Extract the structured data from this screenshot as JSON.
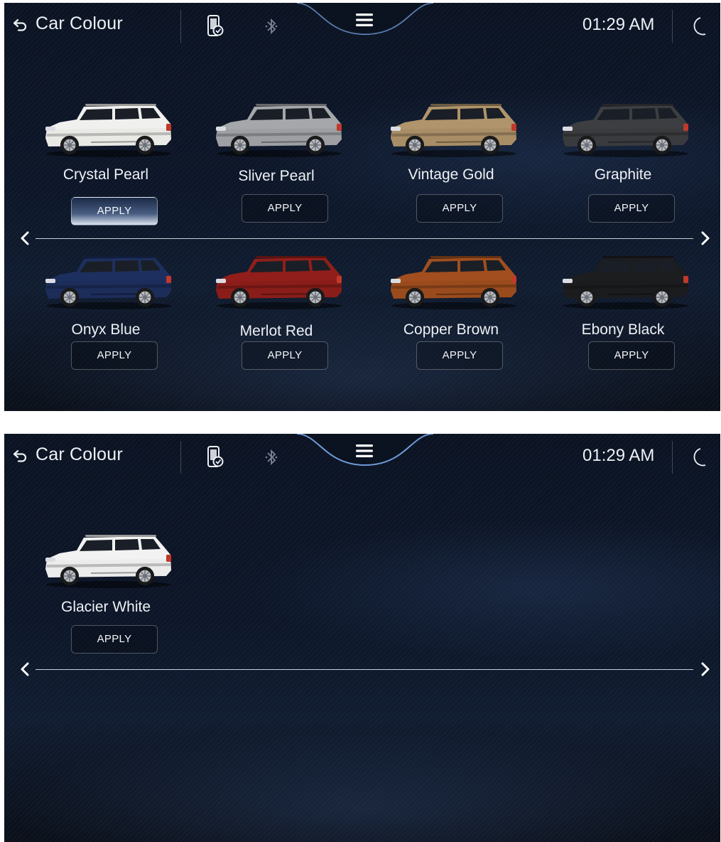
{
  "header": {
    "title": "Car Colour",
    "clock": "01:29 AM",
    "icons": [
      "back-icon",
      "phone-sync-icon",
      "bluetooth-icon",
      "menu-icon",
      "moon-icon"
    ]
  },
  "colors": {
    "accent": "#6f9bd6",
    "background": "#0c1628"
  },
  "page1": {
    "cars": [
      {
        "name": "Crystal Pearl",
        "apply_label": "APPLY",
        "color": "#e9e9e6",
        "selected": true
      },
      {
        "name": "Sliver Pearl",
        "apply_label": "APPLY",
        "color": "#9d9fa3",
        "selected": false
      },
      {
        "name": "Vintage Gold",
        "apply_label": "APPLY",
        "color": "#a88d66",
        "selected": false
      },
      {
        "name": "Graphite",
        "apply_label": "APPLY",
        "color": "#3a3b3e",
        "selected": false
      },
      {
        "name": "Onyx Blue",
        "apply_label": "APPLY",
        "color": "#1c2d5a",
        "selected": false
      },
      {
        "name": "Merlot Red",
        "apply_label": "APPLY",
        "color": "#8a1d19",
        "selected": false
      },
      {
        "name": "Copper Brown",
        "apply_label": "APPLY",
        "color": "#9a4b1d",
        "selected": false
      },
      {
        "name": "Ebony Black",
        "apply_label": "APPLY",
        "color": "#1b1c1e",
        "selected": false
      }
    ]
  },
  "page2": {
    "cars": [
      {
        "name": "Glacier White",
        "apply_label": "APPLY",
        "color": "#ececec",
        "selected": false
      }
    ]
  }
}
